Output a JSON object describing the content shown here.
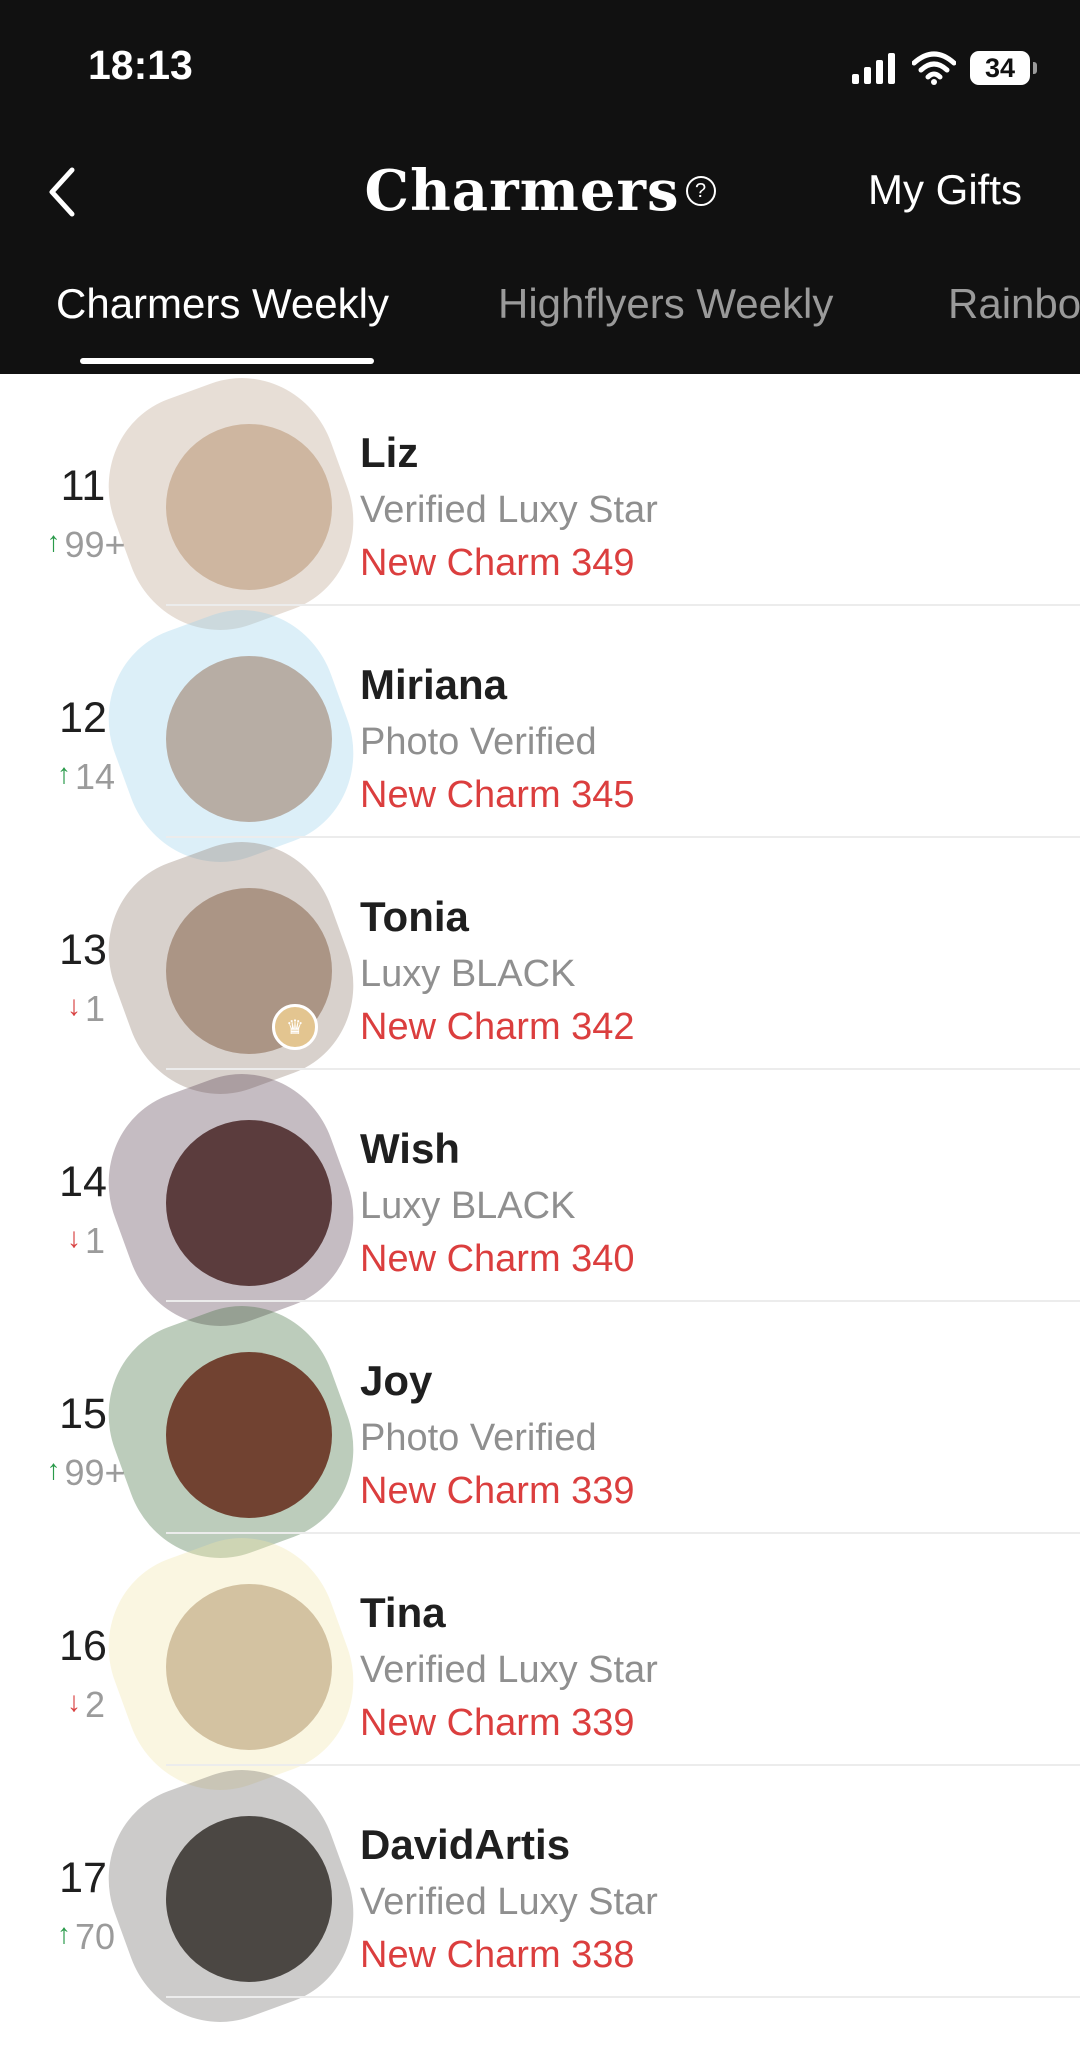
{
  "status_bar": {
    "time": "18:13",
    "battery": "34"
  },
  "header": {
    "title": "Charmers",
    "help_icon": "?",
    "my_gifts": "My Gifts"
  },
  "tabs": [
    {
      "label": "Charmers Weekly",
      "active": true
    },
    {
      "label": "Highflyers Weekly",
      "active": false
    },
    {
      "label": "Rainbo",
      "active": false
    }
  ],
  "rows": [
    {
      "rank": "11",
      "direction": "up",
      "change": "99+",
      "name": "Liz",
      "status": "Verified Luxy Star",
      "charm": "New Charm 349",
      "avatar_color": "#d9c2ad",
      "scribble_color": "#b9a08a"
    },
    {
      "rank": "12",
      "direction": "up",
      "change": "14",
      "name": "Miriana",
      "status": "Photo Verified",
      "charm": "New Charm 345",
      "avatar_color": "#c79a7f",
      "scribble_color": "#9cd0ea"
    },
    {
      "rank": "13",
      "direction": "down",
      "change": "1",
      "name": "Tonia",
      "status": "Luxy BLACK",
      "charm": "New Charm 342",
      "avatar_color": "#bba393",
      "scribble_color": "#8f7b6e",
      "crown": true
    },
    {
      "rank": "14",
      "direction": "down",
      "change": "1",
      "name": "Wish",
      "status": "Luxy BLACK",
      "charm": "New Charm 340",
      "avatar_color": "#5c3b34",
      "scribble_color": "#5a4050"
    },
    {
      "rank": "15",
      "direction": "up",
      "change": "99+",
      "name": "Joy",
      "status": "Photo Verified",
      "charm": "New Charm 339",
      "avatar_color": "#8c2c2c",
      "scribble_color": "#3f6e3c"
    },
    {
      "rank": "16",
      "direction": "down",
      "change": "2",
      "name": "Tina",
      "status": "Verified Luxy Star",
      "charm": "New Charm 339",
      "avatar_color": "#c3b09d",
      "scribble_color": "#f1e4a8"
    },
    {
      "rank": "17",
      "direction": "up",
      "change": "70",
      "name": "DavidArtis",
      "status": "Verified Luxy Star",
      "charm": "New Charm 338",
      "avatar_color": "#3a3531",
      "scribble_color": "#6e6a66"
    }
  ],
  "colors": {
    "header_bg": "#111111",
    "charm_red": "#db3e3e",
    "up_green": "#2a9a4a",
    "down_red": "#d94343"
  }
}
